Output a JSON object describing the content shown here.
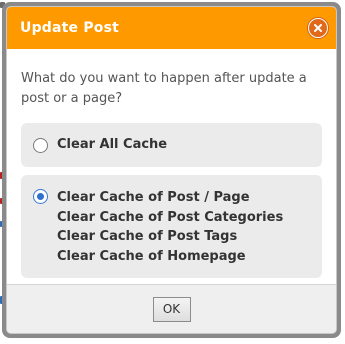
{
  "dialog": {
    "title": "Update Post",
    "close_icon": "close-icon",
    "question": "What do you want to happen after update a post or a page?",
    "options": [
      {
        "selected": false,
        "lines": [
          "Clear All Cache"
        ]
      },
      {
        "selected": true,
        "lines": [
          "Clear Cache of Post / Page",
          "Clear Cache of Post Categories",
          "Clear Cache of Post Tags",
          "Clear Cache of Homepage"
        ]
      }
    ],
    "ok_label": "OK"
  },
  "colors": {
    "title_bar": "#ff9900",
    "close_button": "#e06a1a",
    "radio_selected": "#2f6fcf",
    "option_background": "#ebebeb"
  }
}
